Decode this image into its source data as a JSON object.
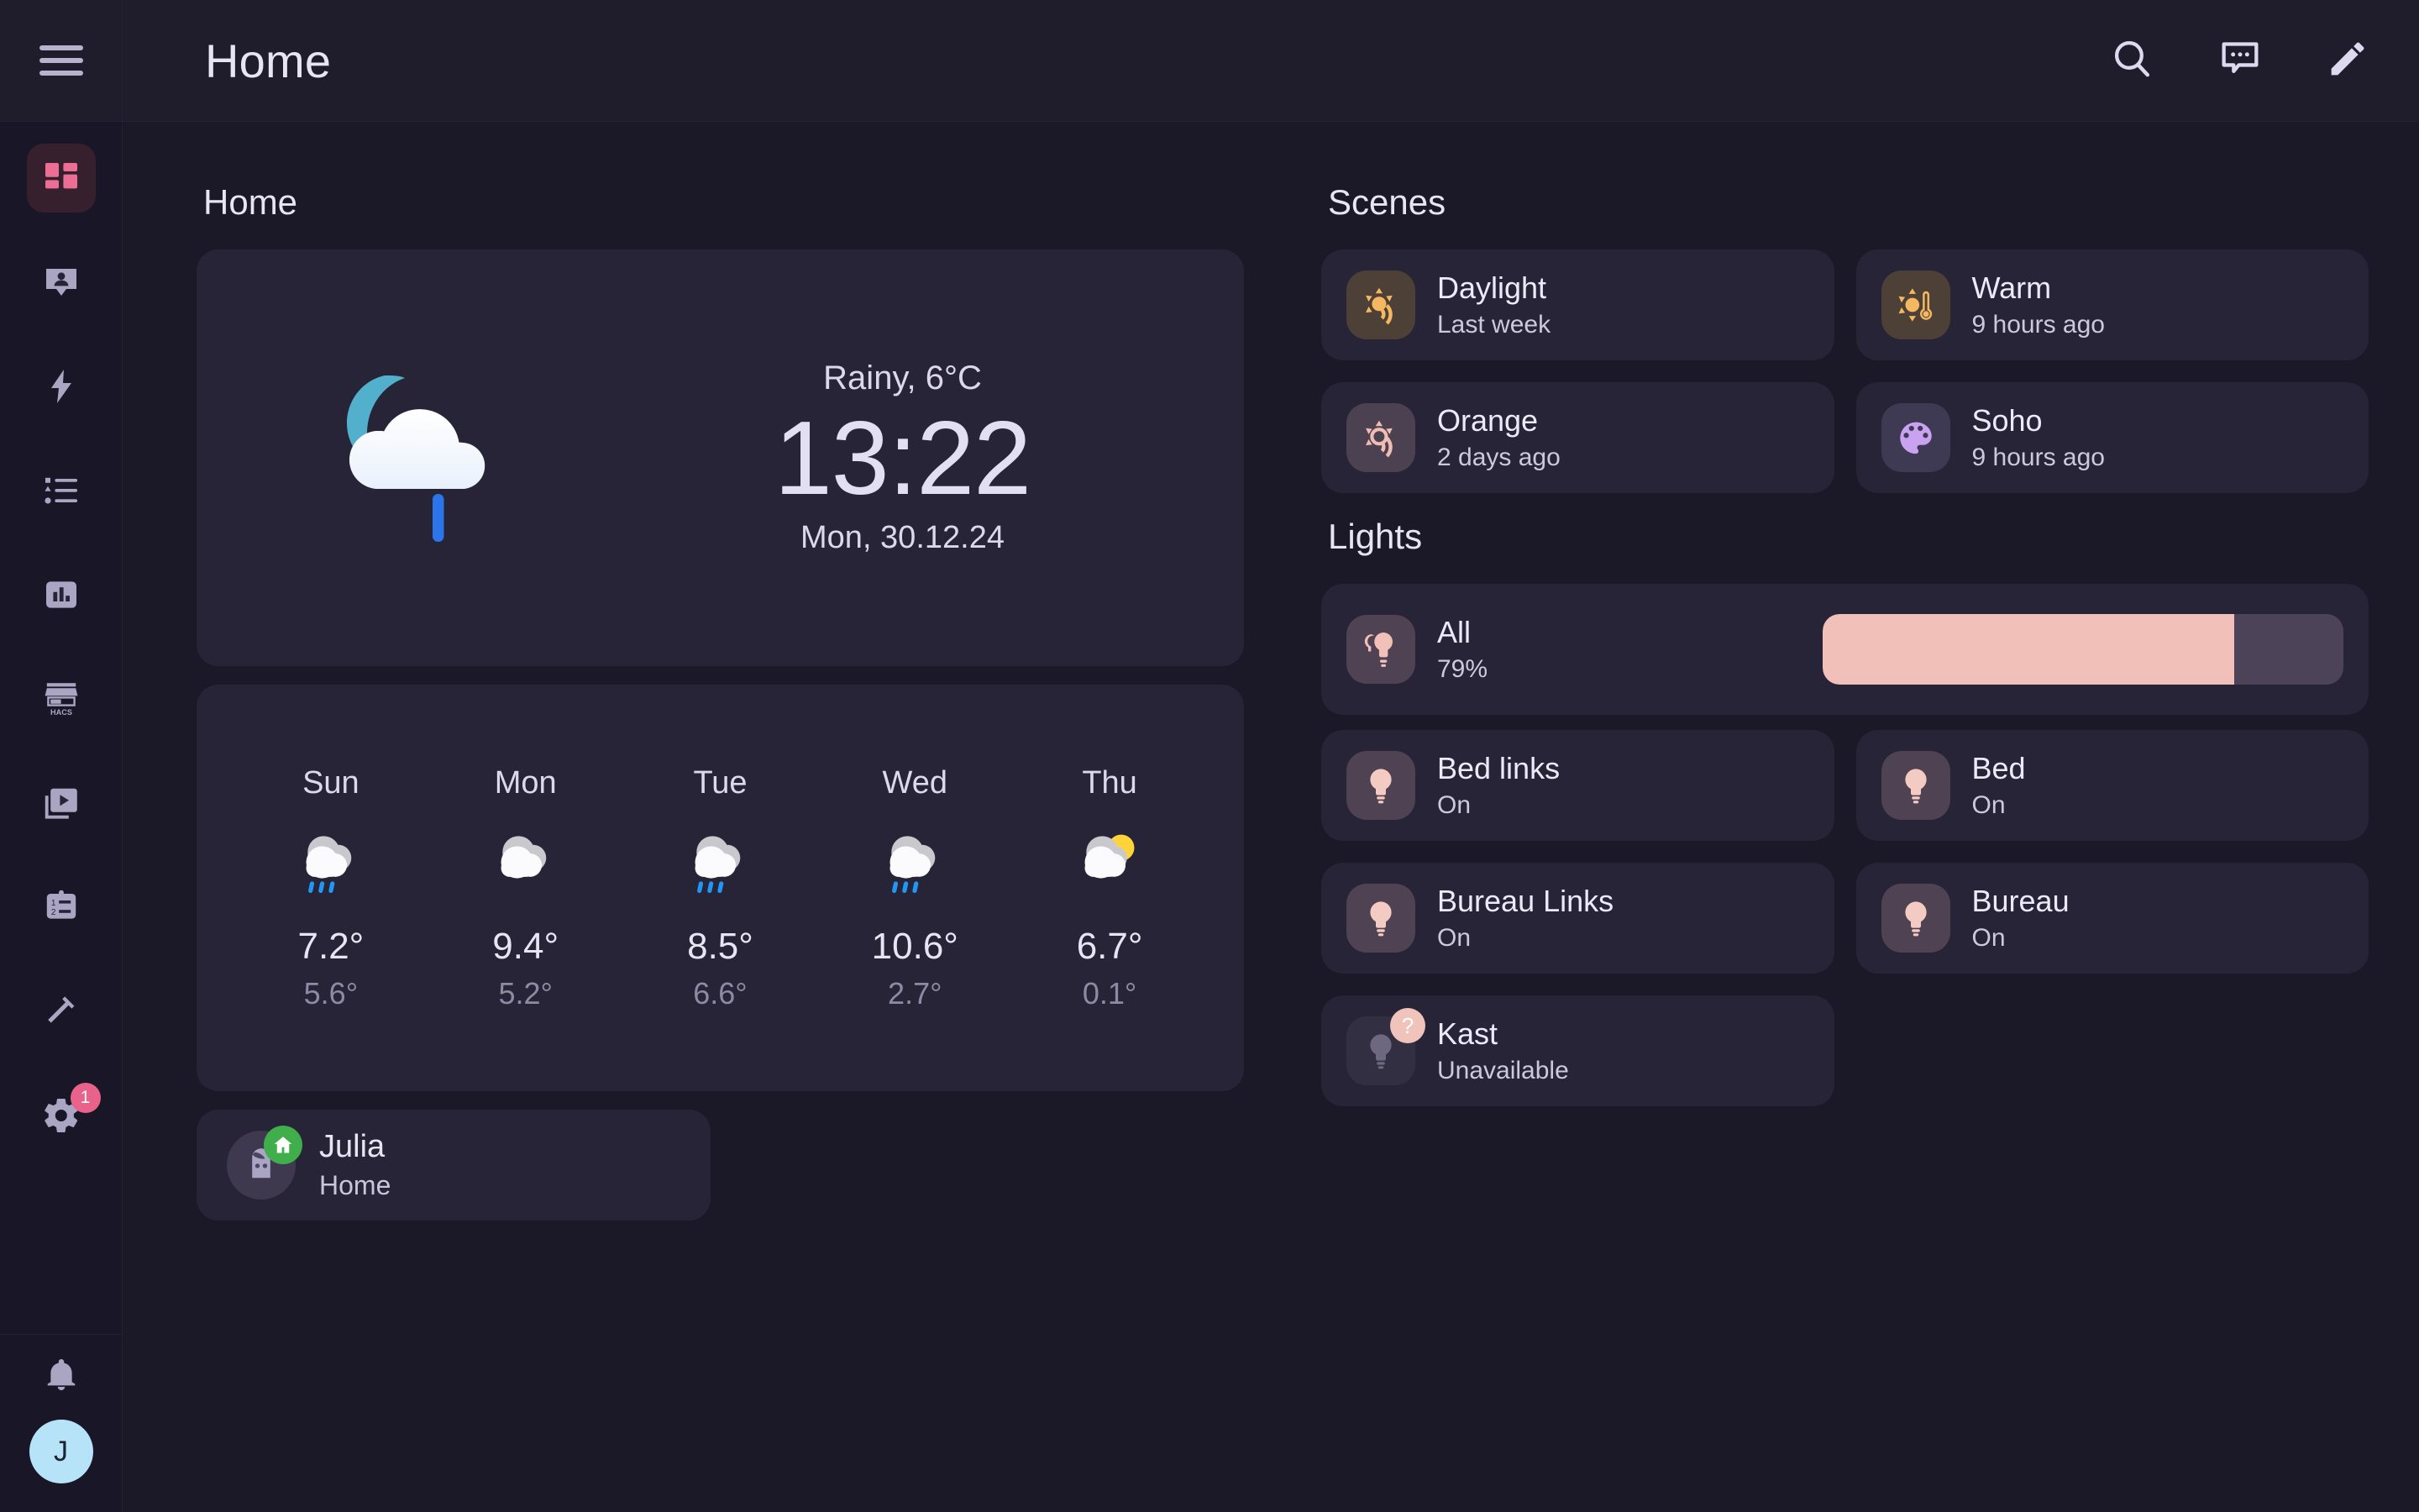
{
  "app": {
    "background_color": "#1b1827",
    "card_color": "#272438",
    "accent_color": "#e9628a"
  },
  "sidebar": {
    "menu_icon": "hamburger-menu-icon",
    "items": [
      {
        "name": "overview",
        "icon": "dashboard-grid-icon",
        "active": true
      },
      {
        "name": "map",
        "icon": "account-badge-icon",
        "active": false
      },
      {
        "name": "energy",
        "icon": "lightning-bolt-icon",
        "active": false
      },
      {
        "name": "logbook",
        "icon": "format-list-icon",
        "active": false
      },
      {
        "name": "history",
        "icon": "chart-bar-icon",
        "active": false
      },
      {
        "name": "hacs",
        "icon": "hacs-storefront-icon",
        "active": false
      },
      {
        "name": "media",
        "icon": "media-play-icon",
        "active": false
      },
      {
        "name": "todo",
        "icon": "clipboard-list-icon",
        "active": false
      },
      {
        "name": "developer-tools",
        "icon": "hammer-icon",
        "active": false
      },
      {
        "name": "settings",
        "icon": "gear-icon",
        "active": false,
        "badge": "1"
      }
    ],
    "bottom": {
      "notifications_icon": "bell-icon",
      "user_initial": "J"
    }
  },
  "header": {
    "title": "Home",
    "actions": [
      {
        "name": "search-button",
        "icon": "search-icon"
      },
      {
        "name": "assist-button",
        "icon": "chat-bubble-icon"
      },
      {
        "name": "edit-dashboard-button",
        "icon": "pencil-icon"
      }
    ]
  },
  "left_column": {
    "section_title": "Home",
    "weather": {
      "icon": "night-rainy-icon",
      "condition": "Rainy, 6°C",
      "time": "13:22",
      "date": "Mon, 30.12.24"
    },
    "forecast": [
      {
        "day": "Sun",
        "icon": "rainy-icon",
        "high": "7.2°",
        "low": "5.6°"
      },
      {
        "day": "Mon",
        "icon": "cloudy-icon",
        "high": "9.4°",
        "low": "5.2°"
      },
      {
        "day": "Tue",
        "icon": "rainy-icon",
        "high": "8.5°",
        "low": "6.6°"
      },
      {
        "day": "Wed",
        "icon": "rainy-icon",
        "high": "10.6°",
        "low": "2.7°"
      },
      {
        "day": "Thu",
        "icon": "partly-cloudy-icon",
        "high": "6.7°",
        "low": "0.1°"
      }
    ],
    "person": {
      "icon": "person-avatar-icon",
      "badge_icon": "home-badge-icon",
      "name": "Julia",
      "state": "Home"
    }
  },
  "right_column": {
    "scenes": {
      "title": "Scenes",
      "items": [
        {
          "name": "Daylight",
          "state": "Last week",
          "icon": "sun-wireless-icon",
          "icon_color": "#f5b860",
          "icon_bg": "#4d4137"
        },
        {
          "name": "Warm",
          "state": "9 hours ago",
          "icon": "sun-thermometer-icon",
          "icon_color": "#f5b860",
          "icon_bg": "#4d4137"
        },
        {
          "name": "Orange",
          "state": "2 days ago",
          "icon": "sun-wireless-icon",
          "icon_color": "#f0bdb3",
          "icon_bg": "#4c4150"
        },
        {
          "name": "Soho",
          "state": "9 hours ago",
          "icon": "palette-icon",
          "icon_color": "#c9a2f0",
          "icon_bg": "#3f3a54"
        }
      ]
    },
    "lights": {
      "title": "Lights",
      "all": {
        "name": "All",
        "state": "79%",
        "brightness_percent": 79,
        "icon": "lightbulb-group-icon",
        "icon_color": "#f0c0b9",
        "icon_bg": "#4e4253",
        "slider_fill_color": "#f0c0b9",
        "slider_track_color": "#4d4359"
      },
      "items": [
        {
          "name": "Bed links",
          "state": "On",
          "icon": "lightbulb-icon",
          "icon_color": "#f3cbc2",
          "icon_bg": "#4e4253",
          "unavailable": false
        },
        {
          "name": "Bed",
          "state": "On",
          "icon": "lightbulb-icon",
          "icon_color": "#f3cbc2",
          "icon_bg": "#4e4253",
          "unavailable": false
        },
        {
          "name": "Bureau Links",
          "state": "On",
          "icon": "lightbulb-icon",
          "icon_color": "#f3cbc2",
          "icon_bg": "#4e4253",
          "unavailable": false
        },
        {
          "name": "Bureau",
          "state": "On",
          "icon": "lightbulb-icon",
          "icon_color": "#f3cbc2",
          "icon_bg": "#4e4253",
          "unavailable": false
        },
        {
          "name": "Kast",
          "state": "Unavailable",
          "icon": "lightbulb-icon",
          "icon_color": "#6d6880",
          "icon_bg": "#322f42",
          "unavailable": true,
          "badge": "?"
        }
      ]
    }
  }
}
